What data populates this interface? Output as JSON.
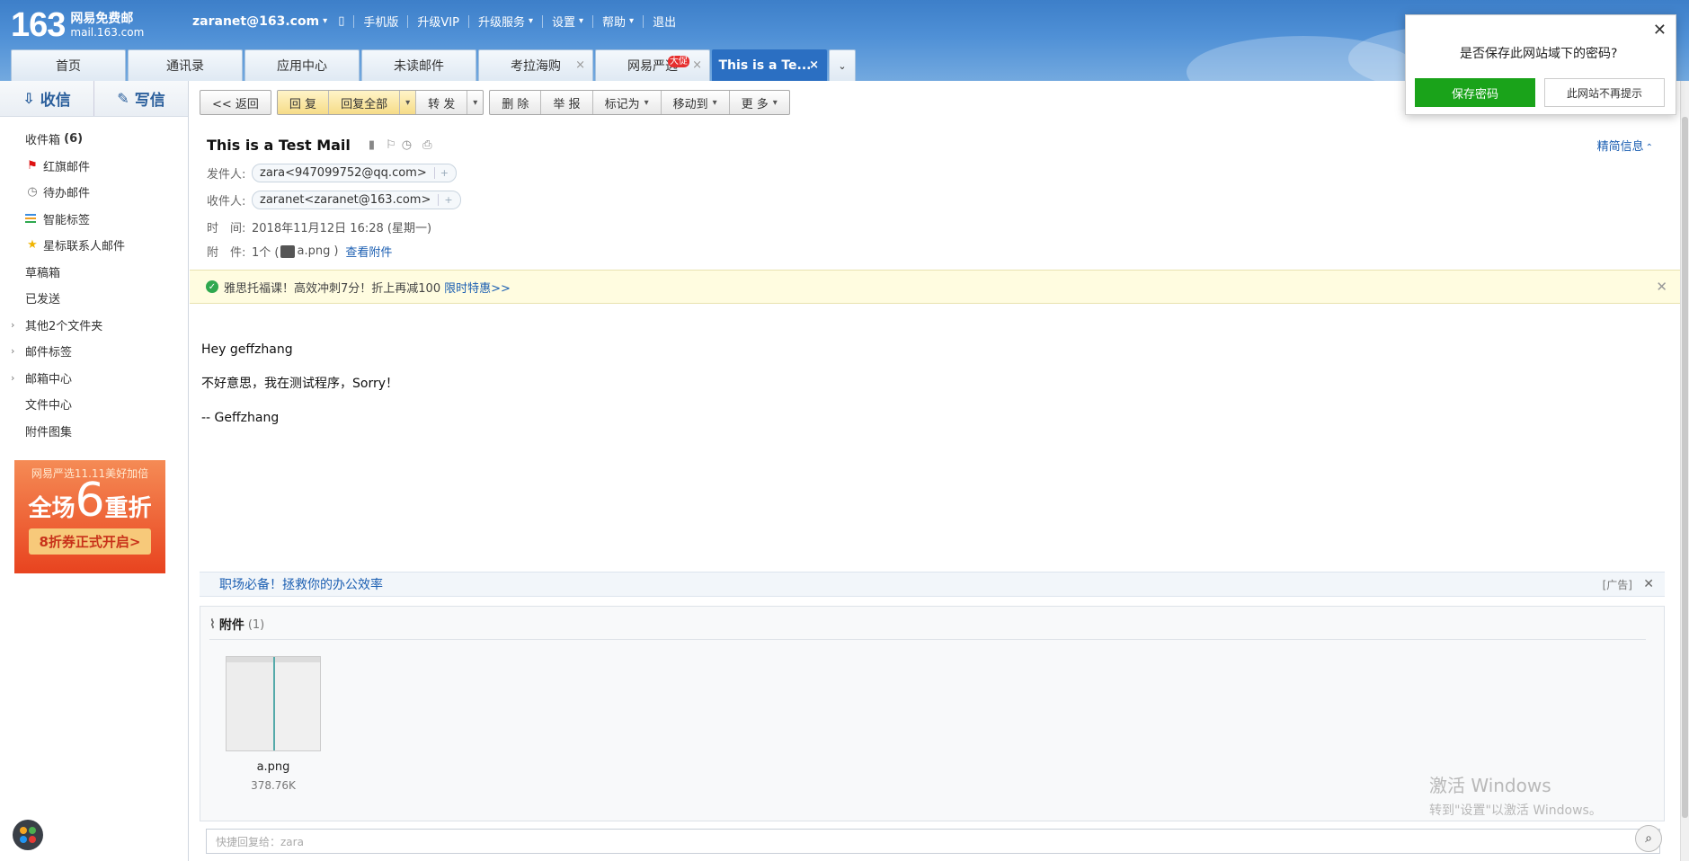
{
  "app": {
    "logo_number": "163",
    "logo_title": "网易免费邮",
    "logo_domain": "mail.163.com"
  },
  "nav": {
    "user": "zaranet@163.com",
    "items": [
      "手机版",
      "升级VIP",
      "升级服务",
      "设置",
      "帮助",
      "退出"
    ]
  },
  "tabs": [
    {
      "label": "首页"
    },
    {
      "label": "通讯录"
    },
    {
      "label": "应用中心"
    },
    {
      "label": "未读邮件"
    },
    {
      "label": "考拉海购"
    },
    {
      "label": "网易严选",
      "badge": "大促"
    },
    {
      "label": "This is a Te..."
    }
  ],
  "sidebar": {
    "receive": "收信",
    "write": "写信",
    "folders": [
      {
        "label": "收件箱",
        "count": "(6)"
      },
      {
        "label": "红旗邮件"
      },
      {
        "label": "待办邮件"
      },
      {
        "label": "智能标签"
      },
      {
        "label": "星标联系人邮件"
      },
      {
        "label": "草稿箱"
      },
      {
        "label": "已发送"
      },
      {
        "label": "其他2个文件夹"
      },
      {
        "label": "邮件标签"
      },
      {
        "label": "邮箱中心"
      },
      {
        "label": "文件中心"
      },
      {
        "label": "附件图集"
      }
    ],
    "ad": {
      "line1": "网易严选11.11美好加倍",
      "line2_a": "全场",
      "line2_b": "6",
      "line2_c": "重折",
      "line3": "8折券正式开启>"
    }
  },
  "toolbar": {
    "back": "<< 返回",
    "reply": "回 复",
    "reply_all": "回复全部",
    "forward": "转 发",
    "delete": "删 除",
    "report": "举 报",
    "mark": "标记为",
    "move": "移动到",
    "more": "更 多"
  },
  "mail": {
    "subject": "This is a Test Mail",
    "detail_link": "精简信息",
    "from_label": "发件人:",
    "from": "zara<947099752@qq.com>",
    "to_label": "收件人:",
    "to": "zaranet<zaranet@163.com>",
    "time_label": "时　间:",
    "time": "2018年11月12日 16:28 (星期一)",
    "attach_label": "附　件:",
    "attach_count": "1个 (",
    "attach_file": "a.png",
    "attach_close": ")",
    "attach_view": "查看附件",
    "notice_text": "雅思托福课！高效冲刺7分！折上再减100",
    "notice_link": "限时特惠>>",
    "body": [
      "Hey geffzhang",
      "不好意思，我在测试程序，Sorry！",
      "-- Geffzhang"
    ],
    "ad_text": "职场必备！拯救你的办公效率",
    "ad_tag": "[广告]",
    "attachments_title": "附件",
    "attachments_count": "(1)",
    "file_name": "a.png",
    "file_size": "378.76K",
    "reply_placeholder": "快捷回复给：zara"
  },
  "watermark": {
    "line1": "激活 Windows",
    "line2": "转到\"设置\"以激活 Windows。"
  },
  "password_popup": {
    "question": "是否保存此网站域下的密码?",
    "save": "保存密码",
    "never": "此网站不再提示"
  },
  "colors": {
    "brand_blue": "#2b6fc2",
    "save_green": "#1aa31a",
    "notice_bg": "#fffce0"
  }
}
